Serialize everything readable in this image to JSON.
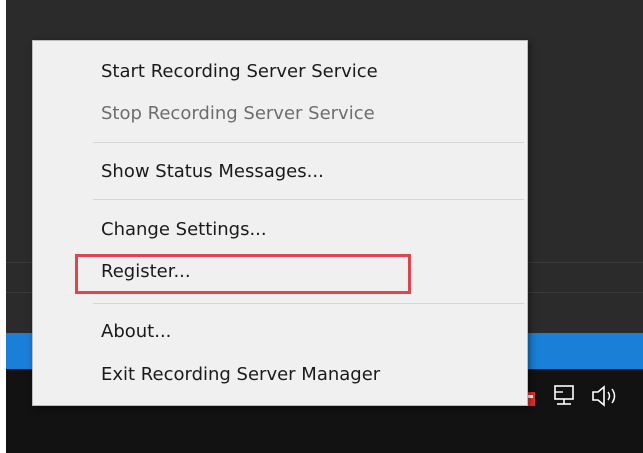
{
  "context_menu": {
    "items": [
      {
        "label": "Start Recording Server Service",
        "enabled": true
      },
      {
        "label": "Stop Recording Server Service",
        "enabled": false
      },
      {
        "label": "Show Status Messages...",
        "enabled": true
      },
      {
        "label": "Change Settings...",
        "enabled": true
      },
      {
        "label": "Register...",
        "enabled": true,
        "highlighted": true
      },
      {
        "label": "About...",
        "enabled": true
      },
      {
        "label": "Exit Recording Server Manager",
        "enabled": true
      }
    ]
  },
  "taskbar": {
    "tray_icons": [
      "people-icon",
      "chevron-up-icon",
      "recording-server-manager-icon",
      "network-icon",
      "volume-icon"
    ]
  },
  "colors": {
    "highlight": "#e0454f",
    "taskbar": "#121212",
    "accent_blue": "#1a7fd6",
    "menu_background": "#f0f0f0",
    "disabled_text": "#6d6d6d"
  }
}
